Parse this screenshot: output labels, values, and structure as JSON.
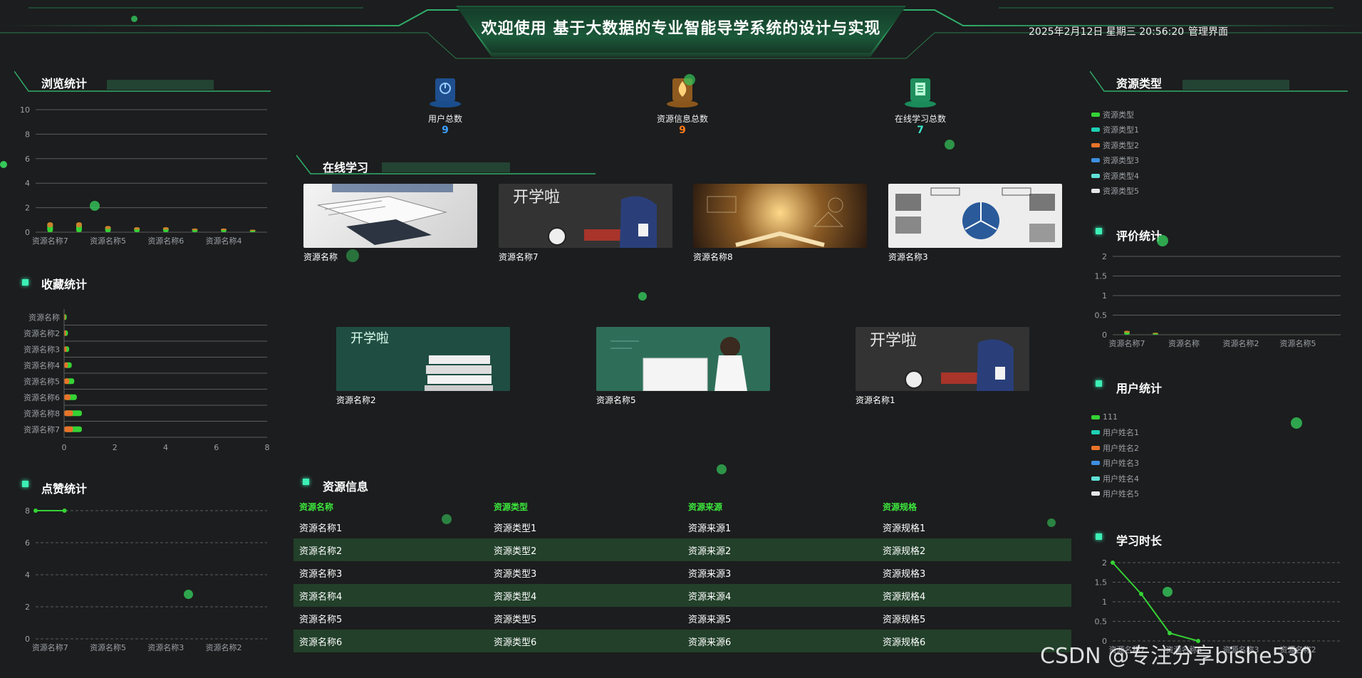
{
  "header": {
    "title": "欢迎使用 基于大数据的专业智能导学系统的设计与实现",
    "datetime": "2025年2月12日 星期三 20:56:20",
    "admin_link": "管理界面"
  },
  "sections": {
    "browse": "浏览统计",
    "favorite": "收藏统计",
    "like": "点赞统计",
    "online": "在线学习",
    "resource_info": "资源信息",
    "resource_type": "资源类型",
    "rating": "评价统计",
    "user": "用户统计",
    "study_time": "学习时长"
  },
  "stats": [
    {
      "label": "用户总数",
      "value": "9",
      "color": "#3aa0ff",
      "icon": "thermometer-icon"
    },
    {
      "label": "资源信息总数",
      "value": "9",
      "color": "#ff7a1a",
      "icon": "flame-icon"
    },
    {
      "label": "在线学习总数",
      "value": "7",
      "color": "#3ce6a0",
      "icon": "clipboard-icon"
    }
  ],
  "courses_row1": [
    {
      "name": "资源名称",
      "image": "open-book"
    },
    {
      "name": "资源名称7",
      "image": "chalkboard-backpack"
    },
    {
      "name": "资源名称8",
      "image": "glowing-book"
    },
    {
      "name": "资源名称3",
      "image": "mind-map"
    }
  ],
  "courses_row2": [
    {
      "name": "资源名称2",
      "image": "chalkboard-books"
    },
    {
      "name": "资源名称5",
      "image": "teacher-chalkboard"
    },
    {
      "name": "资源名称1",
      "image": "chalkboard-backpack"
    }
  ],
  "table": {
    "headers": [
      "资源名称",
      "资源类型",
      "资源来源",
      "资源规格"
    ],
    "rows": [
      [
        "资源名称1",
        "资源类型1",
        "资源来源1",
        "资源规格1"
      ],
      [
        "资源名称2",
        "资源类型2",
        "资源来源2",
        "资源规格2"
      ],
      [
        "资源名称3",
        "资源类型3",
        "资源来源3",
        "资源规格3"
      ],
      [
        "资源名称4",
        "资源类型4",
        "资源来源4",
        "资源规格4"
      ],
      [
        "资源名称5",
        "资源类型5",
        "资源来源5",
        "资源规格5"
      ],
      [
        "资源名称6",
        "资源类型6",
        "资源来源6",
        "资源规格6"
      ]
    ]
  },
  "legends": {
    "resource_type": [
      {
        "label": "资源类型",
        "color": "#35d235"
      },
      {
        "label": "资源类型1",
        "color": "#1ecfb4"
      },
      {
        "label": "资源类型2",
        "color": "#e8732a"
      },
      {
        "label": "资源类型3",
        "color": "#3d8fe0"
      },
      {
        "label": "资源类型4",
        "color": "#5fe0d8"
      },
      {
        "label": "资源类型5",
        "color": "#e6e6e6"
      }
    ],
    "user": [
      {
        "label": "111",
        "color": "#35d235"
      },
      {
        "label": "用户姓名1",
        "color": "#1ecfb4"
      },
      {
        "label": "用户姓名2",
        "color": "#e8732a"
      },
      {
        "label": "用户姓名3",
        "color": "#3d8fe0"
      },
      {
        "label": "用户姓名4",
        "color": "#5fe0d8"
      },
      {
        "label": "用户姓名5",
        "color": "#e6e6e6"
      }
    ]
  },
  "watermark": "CSDN @专注分享bishe530",
  "chart_data": [
    {
      "id": "browse",
      "type": "bar",
      "categories": [
        "资源名称7",
        "",
        "资源名称5",
        "",
        "资源名称6",
        "",
        "资源名称4",
        ""
      ],
      "values": [
        0.8,
        0.8,
        0.5,
        0.4,
        0.4,
        0.3,
        0.3,
        0.2
      ],
      "yticks": [
        0,
        2,
        4,
        6,
        8,
        10
      ],
      "ylim": [
        0,
        10
      ],
      "grid": true,
      "bar_colors": [
        "#35d235",
        "#e8732a"
      ]
    },
    {
      "id": "favorite",
      "type": "bar",
      "orientation": "horizontal",
      "categories": [
        "资源名称",
        "资源名称2",
        "资源名称3",
        "资源名称4",
        "资源名称5",
        "资源名称6",
        "资源名称8",
        "资源名称7"
      ],
      "values": [
        0.1,
        0.15,
        0.2,
        0.3,
        0.4,
        0.5,
        0.7,
        0.7
      ],
      "xticks": [
        0,
        2,
        4,
        6,
        8
      ],
      "xlim": [
        0,
        8
      ],
      "grid": true,
      "bar_colors": [
        "#e8732a",
        "#35d235"
      ]
    },
    {
      "id": "like",
      "type": "line",
      "categories": [
        "资源名称7",
        "",
        "资源名称5",
        "",
        "资源名称3",
        "",
        "资源名称2",
        ""
      ],
      "values": [
        8,
        8
      ],
      "yticks": [
        0,
        2,
        4,
        6,
        8
      ],
      "ylim": [
        0,
        8
      ],
      "grid": true,
      "line_color": "#35d235"
    },
    {
      "id": "rating",
      "type": "bar",
      "categories": [
        "资源名称7",
        "",
        "资源名称",
        "",
        "资源名称2",
        "",
        "资源名称5",
        ""
      ],
      "values": [
        0.1,
        0.05,
        0,
        0,
        0,
        0,
        0,
        0
      ],
      "yticks": [
        0,
        0.5,
        1,
        1.5,
        2
      ],
      "ylim": [
        0,
        2
      ],
      "grid": true,
      "bar_colors": [
        "#35d235",
        "#e8732a"
      ]
    },
    {
      "id": "study_time",
      "type": "line",
      "categories": [
        "资源名称7",
        "",
        "资源名称5",
        "",
        "资源名称3",
        "",
        "资源名称2",
        ""
      ],
      "values": [
        2,
        1.2,
        0.2,
        0
      ],
      "yticks": [
        0,
        0.5,
        1,
        1.5,
        2
      ],
      "ylim": [
        0,
        2
      ],
      "grid": true,
      "line_color": "#35d235"
    }
  ]
}
